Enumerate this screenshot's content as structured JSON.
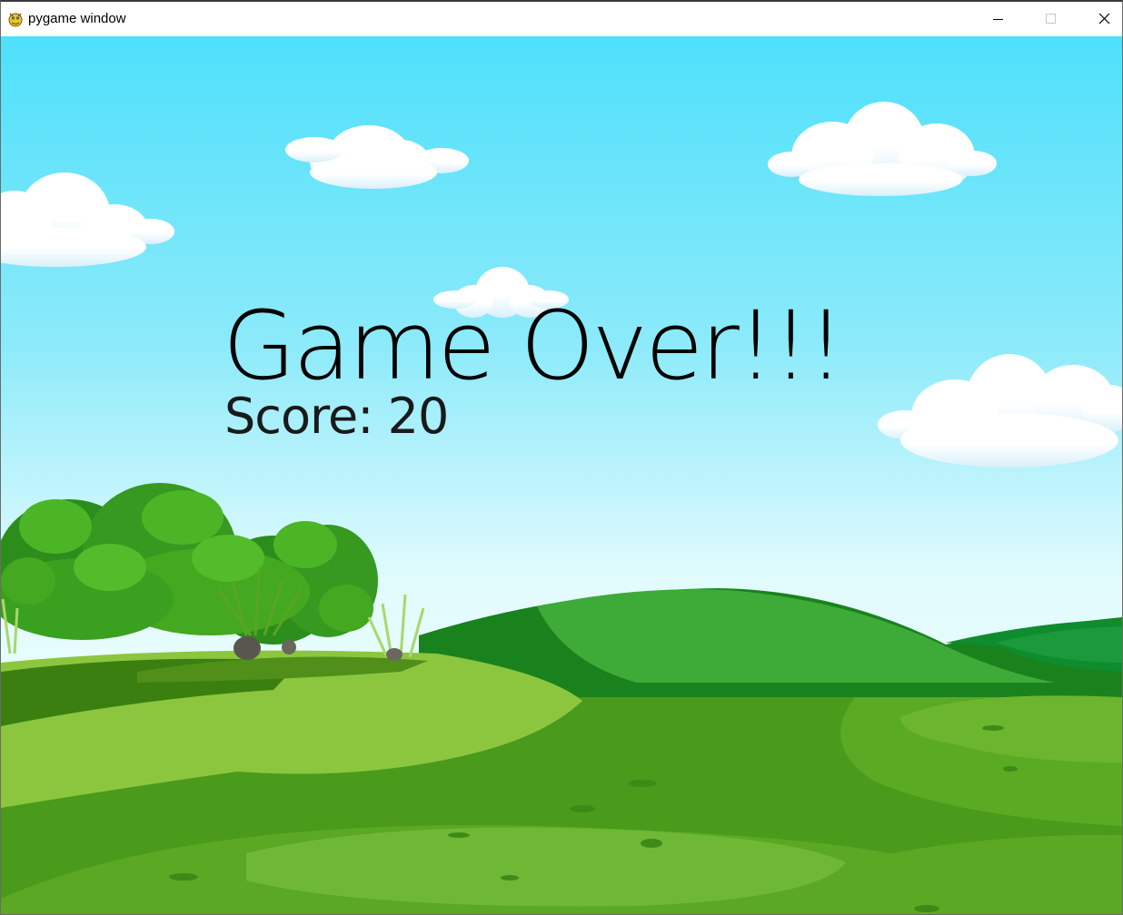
{
  "window": {
    "title": "pygame window",
    "app_icon": "pygame-snake-icon",
    "controls": {
      "minimize_icon": "minimize-icon",
      "maximize_icon": "maximize-icon",
      "close_icon": "close-icon"
    }
  },
  "game": {
    "state": "game_over",
    "message": "Game Over!!!",
    "score_text": "Score: 20",
    "score": 20,
    "scene": "cartoon meadow with clouds, bushes and green hills",
    "colors": {
      "sky_top": "#4fe0fb",
      "sky_bottom": "#e6fbfd",
      "grass_light": "#8cc63f",
      "grass_dark": "#4a9a1c",
      "hill": "#2e9a2a",
      "text": "#000000"
    }
  }
}
